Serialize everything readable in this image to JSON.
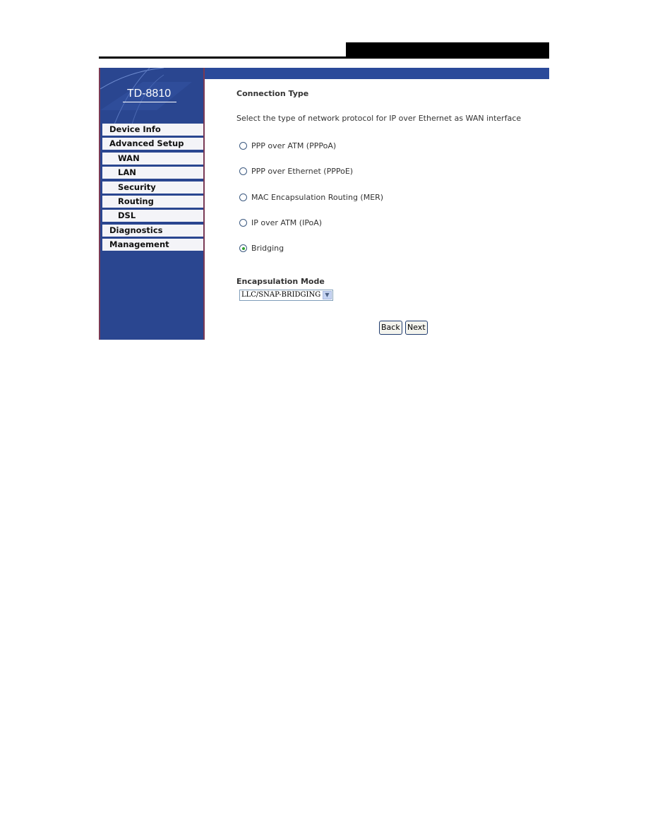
{
  "brand": {
    "model": "TD-8810"
  },
  "sidebar": {
    "items": [
      {
        "label": "Device Info",
        "level": 0
      },
      {
        "label": "Advanced Setup",
        "level": 0
      },
      {
        "label": "WAN",
        "level": 1
      },
      {
        "label": "LAN",
        "level": 1
      },
      {
        "label": "Security",
        "level": 1
      },
      {
        "label": "Routing",
        "level": 1
      },
      {
        "label": "DSL",
        "level": 1
      },
      {
        "label": "Diagnostics",
        "level": 0
      },
      {
        "label": "Management",
        "level": 0
      }
    ]
  },
  "main": {
    "title": "Connection Type",
    "description": "Select the type of network protocol for IP over Ethernet as WAN interface",
    "options": [
      {
        "label": "PPP over ATM (PPPoA)",
        "checked": false
      },
      {
        "label": "PPP over Ethernet (PPPoE)",
        "checked": false
      },
      {
        "label": "MAC Encapsulation Routing (MER)",
        "checked": false
      },
      {
        "label": "IP over ATM (IPoA)",
        "checked": false
      },
      {
        "label": "Bridging",
        "checked": true
      }
    ],
    "encapsulation": {
      "label": "Encapsulation Mode",
      "selected": "LLC/SNAP-BRIDGING",
      "arrow_icon": "chevron-down-icon"
    },
    "buttons": {
      "back": "Back",
      "next": "Next"
    }
  },
  "colors": {
    "sidebar": "#2a4690",
    "accent": "#2fa12f"
  }
}
